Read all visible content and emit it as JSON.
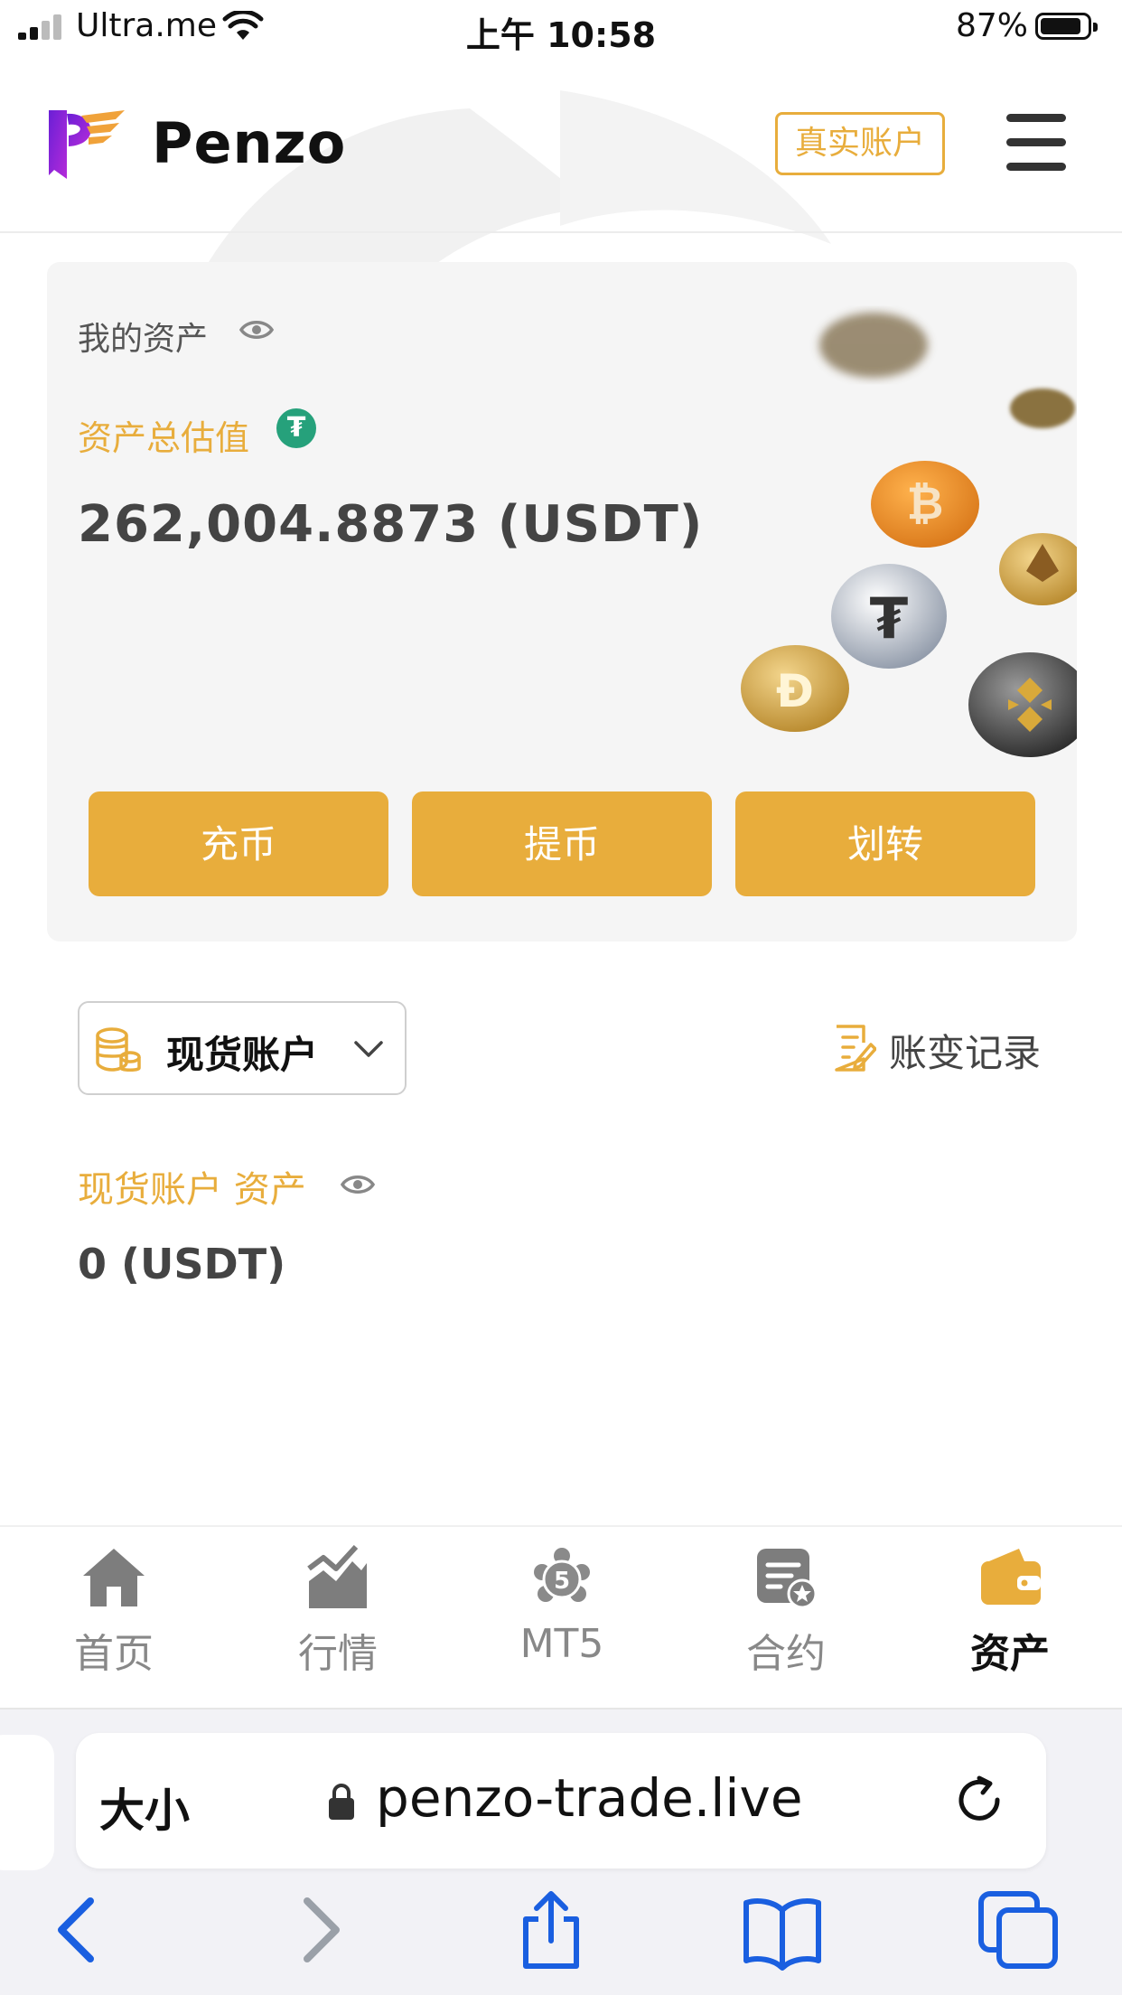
{
  "status_bar": {
    "carrier": "Ultra.me",
    "time": "上午 10:58",
    "battery": "87%",
    "battery_level": 0.87
  },
  "header": {
    "brand": "Penzo",
    "account_badge": "真实账户",
    "icons": [
      "penzo-logo-icon",
      "hamburger-menu-icon"
    ]
  },
  "asset_card": {
    "my_assets_label": "我的资产",
    "total_label": "资产总估值",
    "usdt_glyph": "₮",
    "total_value": "262,004.8873 (USDT)",
    "buttons": {
      "deposit": "充币",
      "withdraw": "提币",
      "transfer": "划转"
    }
  },
  "account": {
    "selected": "现货账户",
    "records_label": "账变记录",
    "spot_assets_label": "现货账户 资产",
    "spot_value": "0 (USDT)"
  },
  "tabbar": {
    "items": [
      {
        "label": "首页",
        "icon": "home-icon"
      },
      {
        "label": "行情",
        "icon": "chart-icon"
      },
      {
        "label": "MT5",
        "icon": "mt5-icon"
      },
      {
        "label": "合约",
        "icon": "contract-icon"
      },
      {
        "label": "资产",
        "icon": "wallet-icon"
      }
    ],
    "active_index": 4,
    "accent": "#e8ad3c"
  },
  "safari": {
    "text_size_label": "大小",
    "url": "penzo-trade.live",
    "icons": [
      "back-icon",
      "forward-icon",
      "share-icon",
      "bookmarks-icon",
      "tabs-icon"
    ]
  },
  "colors": {
    "accent": "#e8ad3c",
    "safari_blue": "#1a5fe0"
  }
}
